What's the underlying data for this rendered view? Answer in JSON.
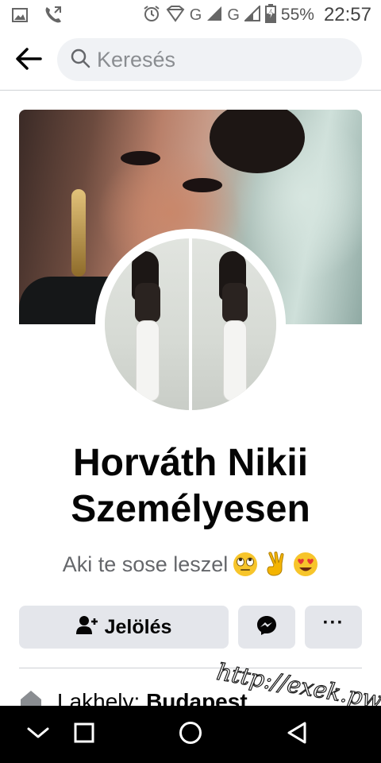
{
  "status_bar": {
    "network_1": "G",
    "network_2": "G",
    "battery": "55%",
    "time": "22:57",
    "icons": [
      "image-icon",
      "phone-icon",
      "alarm-icon",
      "data-saver-icon",
      "signal-icon",
      "battery-icon"
    ]
  },
  "header": {
    "search_placeholder": "Keresés",
    "back_icon": "arrow-left-icon",
    "search_icon": "search-icon"
  },
  "profile": {
    "name": "Horváth Nikii Személyesen",
    "bio": "Aki te sose leszel",
    "bio_emojis": [
      "face-with-rolling-eyes-icon",
      "victory-hand-icon",
      "heart-eyes-icon"
    ]
  },
  "actions": {
    "add_friend_label": "Jelölés",
    "add_friend_icon": "add-friend-icon",
    "messenger_icon": "messenger-icon",
    "more_label": "···"
  },
  "about": {
    "residence_label": "Lakhely:",
    "residence_value": "Budapest"
  },
  "watermark": "http://exek.pw",
  "nav_bar": {
    "icons": [
      "chevron-down-icon",
      "recent-apps-icon",
      "home-icon",
      "back-triangle-icon"
    ]
  },
  "colors": {
    "button_bg": "#e4e6eb",
    "search_bg": "#f0f2f5",
    "secondary_text": "#65676b",
    "nav_bar_bg": "#000000"
  }
}
